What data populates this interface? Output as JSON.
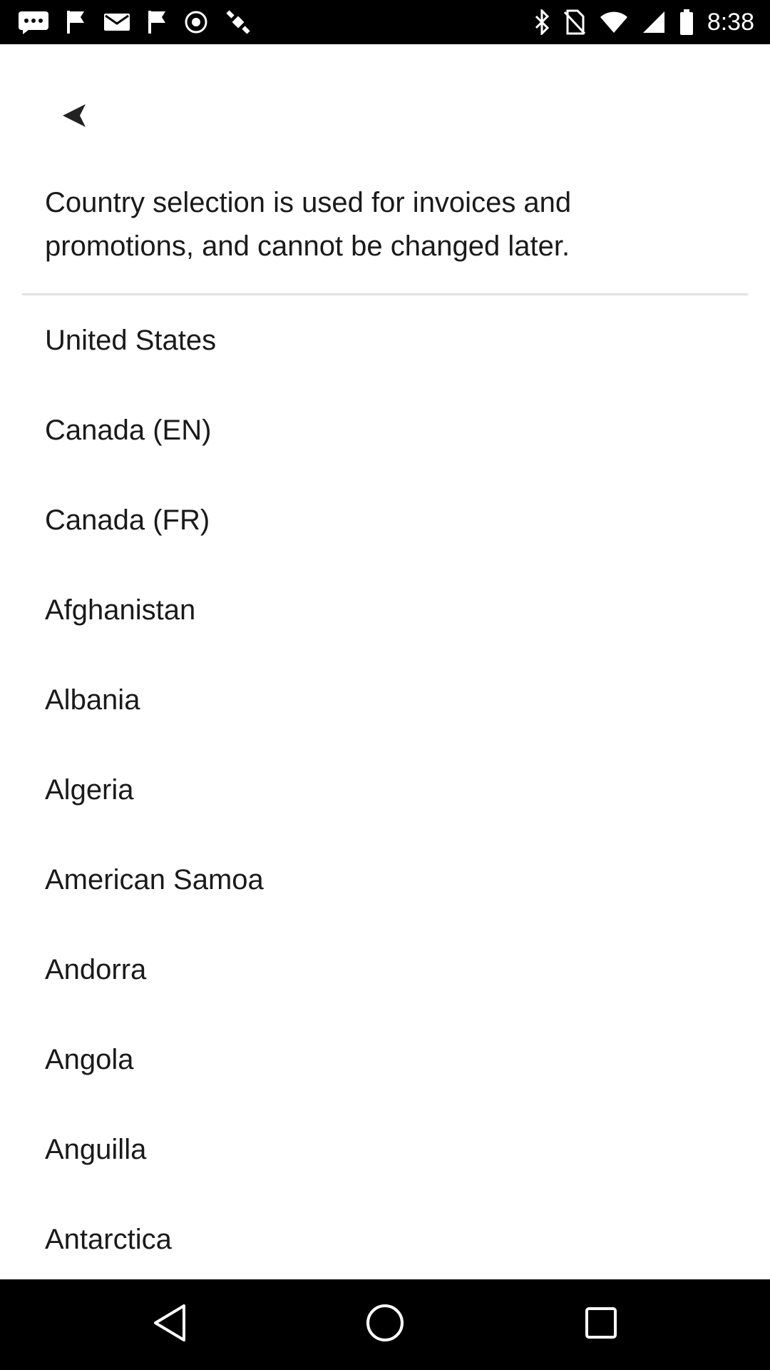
{
  "status_bar": {
    "time": "8:38",
    "left_icons": [
      "message-icon",
      "flag-icon",
      "mail-icon",
      "flag-icon",
      "vpn-icon",
      "satellite-icon"
    ],
    "right_icons": [
      "bluetooth-icon",
      "no-sim-icon",
      "wifi-icon",
      "signal-icon",
      "battery-icon"
    ]
  },
  "header": {
    "back_icon": "back-arrow-icon"
  },
  "notice_text": "Country selection is used for invoices and promotions, and cannot be changed later.",
  "countries": [
    {
      "label": "United States"
    },
    {
      "label": "Canada (EN)"
    },
    {
      "label": "Canada (FR)"
    },
    {
      "label": "Afghanistan"
    },
    {
      "label": "Albania"
    },
    {
      "label": "Algeria"
    },
    {
      "label": "American Samoa"
    },
    {
      "label": "Andorra"
    },
    {
      "label": "Angola"
    },
    {
      "label": "Anguilla"
    },
    {
      "label": "Antarctica"
    }
  ],
  "nav_bar": {
    "buttons": [
      "back-triangle-icon",
      "home-circle-icon",
      "recents-square-icon"
    ]
  }
}
